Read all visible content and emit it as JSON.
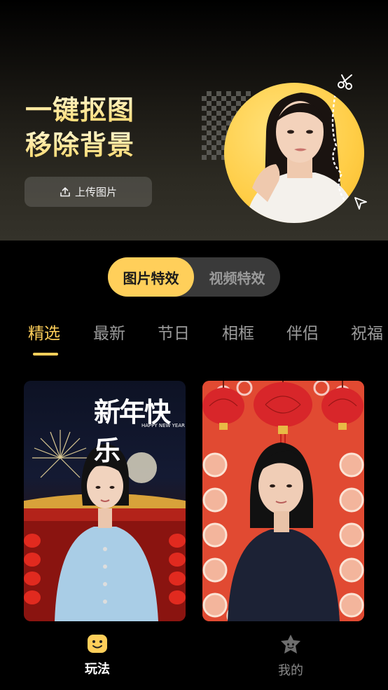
{
  "banner": {
    "headline_line1": "一键抠图",
    "headline_line2": "移除背景",
    "upload_label": "上传图片"
  },
  "effect_toggle": {
    "options": [
      "图片特效",
      "视频特效"
    ],
    "selected": "图片特效"
  },
  "categories": {
    "items": [
      "精选",
      "最新",
      "节日",
      "相框",
      "伴侣",
      "祝福"
    ],
    "selected": "精选"
  },
  "cards": [
    {
      "overlay_title": "新年快乐",
      "overlay_subtitle": "HAPPY NEW YEAR"
    },
    {
      "overlay_title": ""
    }
  ],
  "bottom_nav": {
    "items": [
      {
        "label": "玩法",
        "icon": "smiley-icon"
      },
      {
        "label": "我的",
        "icon": "star-face-icon"
      }
    ],
    "selected": "玩法"
  },
  "colors": {
    "accent": "#ffcf5a",
    "toggle_bg": "#3a3a3a",
    "background": "#000000"
  }
}
